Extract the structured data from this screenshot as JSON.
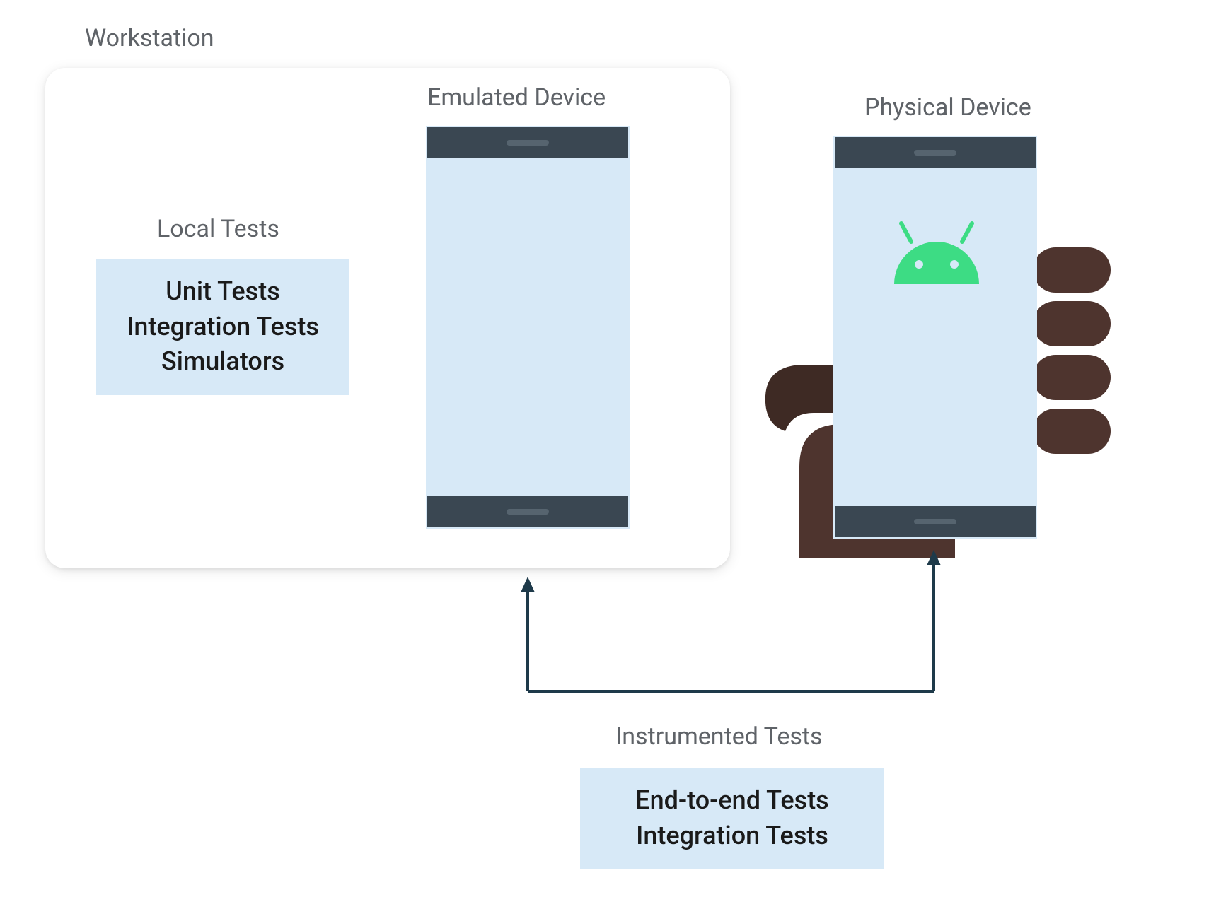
{
  "workstation": {
    "title": "Workstation",
    "local_tests_label": "Local Tests",
    "local_tests": {
      "line1": "Unit Tests",
      "line2": "Integration Tests",
      "line3": "Simulators"
    },
    "emulated_device_label": "Emulated Device"
  },
  "physical_device_label": "Physical Device",
  "instrumented": {
    "label": "Instrumented Tests",
    "tests": {
      "line1": "End-to-end Tests",
      "line2": "Integration Tests"
    }
  },
  "colors": {
    "label_gray": "#5f6368",
    "box_blue": "#d7e9f7",
    "phone_bar": "#3a4752",
    "arrow": "#1e3a4a",
    "android_green": "#3ddc84",
    "hand_brown": "#4e342e"
  }
}
